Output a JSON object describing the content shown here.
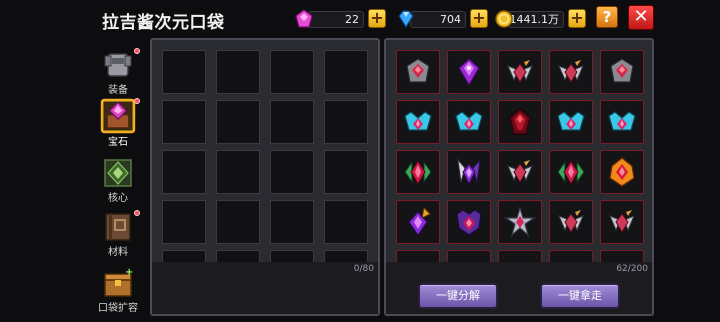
{
  "header": {
    "title": "拉吉酱次元口袋",
    "currencies": [
      {
        "name": "pink-gem",
        "value": "22",
        "color": "#e84bd4"
      },
      {
        "name": "blue-diamond",
        "value": "704",
        "color": "#38a8ff"
      },
      {
        "name": "gold-coin",
        "value": "1441.1万",
        "color": "#f2c22a"
      }
    ],
    "help_label": "?",
    "close_label": "✕",
    "plus_label": "+"
  },
  "sidebar": {
    "tabs": [
      {
        "label": "装备",
        "icon": "armor-icon",
        "active": false,
        "badge": true
      },
      {
        "label": "宝石",
        "icon": "gem-chest-icon",
        "active": true,
        "badge": true
      },
      {
        "label": "核心",
        "icon": "core-icon",
        "active": false,
        "badge": false
      },
      {
        "label": "材料",
        "icon": "material-book-icon",
        "active": false,
        "badge": true
      },
      {
        "label": "口袋扩容",
        "icon": "pocket-expand-icon",
        "active": false,
        "badge": false
      }
    ]
  },
  "pocket": {
    "count": "0/80"
  },
  "inventory": {
    "count": "62/200",
    "gems": [
      [
        "crest-gem-icon",
        "purple-crystal-icon",
        "winged-gem-icon",
        "winged-gem-icon",
        "crest-gem-icon"
      ],
      [
        "cyan-crown-gem-icon",
        "cyan-crown-gem-icon",
        "dark-red-gem-icon",
        "cyan-crown-gem-icon",
        "cyan-crown-gem-icon"
      ],
      [
        "green-leaf-gem-icon",
        "horned-gem-icon",
        "winged-gem-icon",
        "green-leaf-gem-icon",
        "fire-gem-icon"
      ],
      [
        "orange-spike-gem-icon",
        "purple-crest-gem-icon",
        "star-gem-icon",
        "winged-gem-icon",
        "winged-gem-icon"
      ]
    ]
  },
  "actions": {
    "decompose_label": "一键分解",
    "take_all_label": "一键拿走"
  }
}
